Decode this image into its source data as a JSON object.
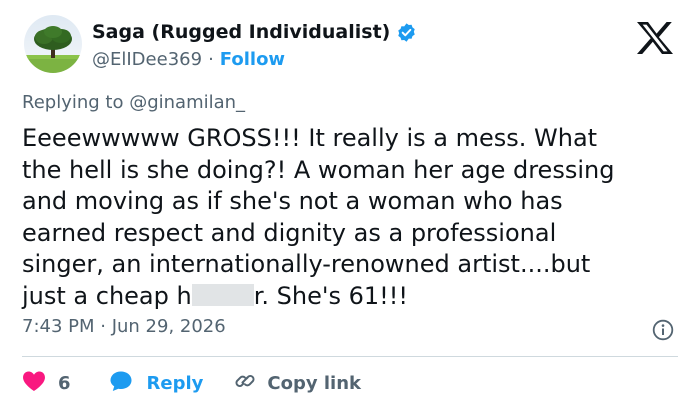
{
  "author": {
    "display_name": "Saga (Rugged Individualist)",
    "handle": "@ElIDee369",
    "separator": "·",
    "follow_label": "Follow"
  },
  "reply_to": "Replying to @ginamilan_",
  "tweet": {
    "text_before_redaction": "Eeeewwwww GROSS!!! It really is a mess. What\nthe hell is she doing?!  A woman her age dressing\nand moving as if she's not a woman who has\nearned respect and dignity as a professional\nsinger, an internationally-renowned artist....but\njust a cheap h",
    "text_after_redaction": "r. She's 61!!!"
  },
  "timestamp": "7:43 PM · Jun 29, 2026",
  "actions": {
    "like_count": "6",
    "reply_label": "Reply",
    "copy_link_label": "Copy link"
  },
  "colors": {
    "accent": "#1d9bf0",
    "like": "#f91880",
    "muted": "#536471",
    "text": "#0f1419",
    "redaction": "#e1e4e6"
  },
  "icons": [
    "x-logo-icon",
    "verified-badge-icon",
    "info-icon",
    "heart-icon",
    "reply-bubble-icon",
    "link-icon"
  ]
}
